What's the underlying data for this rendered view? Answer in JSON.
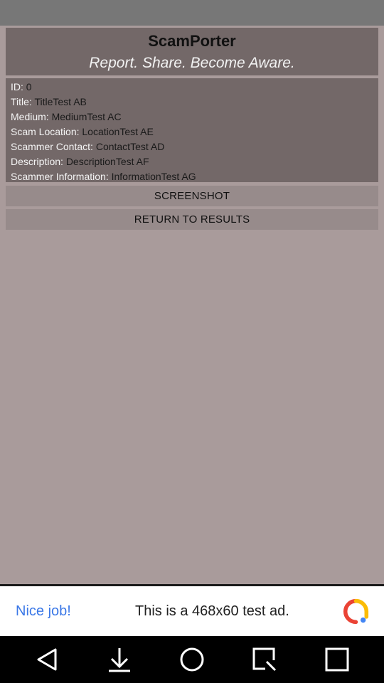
{
  "header": {
    "title": "ScamPorter",
    "tagline": "Report. Share. Become Aware."
  },
  "details": [
    {
      "label": "ID:",
      "value": "0"
    },
    {
      "label": "Title:",
      "value": "TitleTest AB"
    },
    {
      "label": "Medium:",
      "value": "MediumTest AC"
    },
    {
      "label": "Scam Location:",
      "value": "LocationTest AE"
    },
    {
      "label": "Scammer Contact:",
      "value": "ContactTest AD"
    },
    {
      "label": "Description:",
      "value": "DescriptionTest AF"
    },
    {
      "label": "Scammer Information:",
      "value": "InformationTest AG"
    }
  ],
  "buttons": {
    "screenshot": "SCREENSHOT",
    "return": "RETURN TO RESULTS"
  },
  "ad": {
    "headline": "Nice job!",
    "text": "This is a 468x60 test ad.",
    "icon": "adchoices-logo-icon"
  },
  "nav": {
    "icons": [
      "back-icon",
      "download-icon",
      "home-icon",
      "screenshot-icon",
      "recents-icon"
    ]
  },
  "colors": {
    "background": "#a99b9b",
    "panel": "#736868",
    "button": "#978b8b",
    "status_bar": "#777777",
    "ad_link": "#3b78e7"
  }
}
